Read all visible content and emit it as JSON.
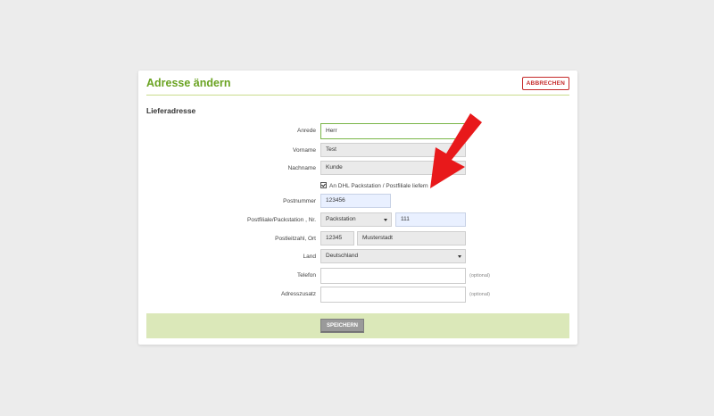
{
  "header": {
    "title": "Adresse ändern",
    "cancel_label": "ABBRECHEN"
  },
  "section": {
    "title": "Lieferadresse"
  },
  "form": {
    "anrede": {
      "label": "Anrede",
      "value": "Herr"
    },
    "vorname": {
      "label": "Vorname",
      "value": "Test"
    },
    "nachname": {
      "label": "Nachname",
      "value": "Kunde"
    },
    "packstation_checkbox": {
      "label": "An DHL Packstation / Postfiliale liefern",
      "checked": true
    },
    "postnummer": {
      "label": "Postnummer",
      "value": "123456"
    },
    "postfiliale": {
      "label": "Postfiliale/Packstation , Nr.",
      "type_value": "Packstation",
      "number_value": "111"
    },
    "plz_ort": {
      "label": "Postleitzahl, Ort",
      "plz_value": "12345",
      "ort_value": "Musterstadt"
    },
    "land": {
      "label": "Land",
      "value": "Deutschland"
    },
    "telefon": {
      "label": "Telefon",
      "value": "",
      "hint": "(optional)"
    },
    "adresszusatz": {
      "label": "Adresszusatz",
      "value": "",
      "hint": "(optional)"
    }
  },
  "footer": {
    "save_label": "SPEICHERN"
  },
  "colors": {
    "title_green": "#6aa322",
    "cancel_red": "#c52a2a",
    "footer_green": "#dbe8b9",
    "arrow_red": "#e8191b"
  },
  "annotation": {
    "icon": "red-arrow-icon"
  }
}
